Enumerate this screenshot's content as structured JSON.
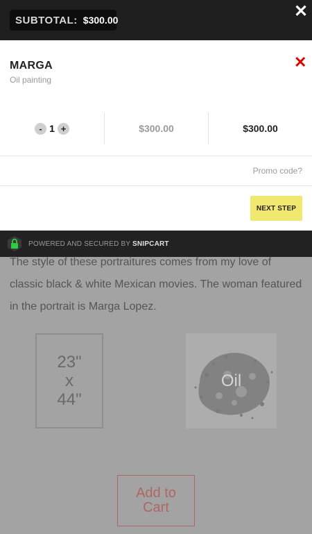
{
  "background": {
    "description_lines": [
      "The style of these portraitures comes from my love of",
      "classic black & white Mexican movies. The woman featured",
      "in the portrait is Marga Lopez."
    ],
    "size": {
      "line1": "23\"",
      "line2": "x",
      "line3": "44\""
    },
    "medium_label": "Oil",
    "add_to_cart": {
      "line1": "Add to",
      "line2": "Cart"
    }
  },
  "cart": {
    "subtotal_label": "SUBTOTAL:",
    "subtotal_value": "$300.00",
    "close_icon": "close-icon",
    "item": {
      "name": "MARGA",
      "subtitle": "Oil painting",
      "quantity": "1",
      "unit_price": "$300.00",
      "total_price": "$300.00",
      "decrement_label": "-",
      "increment_label": "+"
    },
    "promo_label": "Promo code?",
    "next_step_label": "NEXT STEP",
    "footer": {
      "prefix": "POWERED AND SECURED BY",
      "brand": "SNIPCART"
    }
  },
  "colors": {
    "accent_button": "#f1e96f",
    "remove_icon": "#e00000",
    "header_bg": "#1e1e1e"
  }
}
